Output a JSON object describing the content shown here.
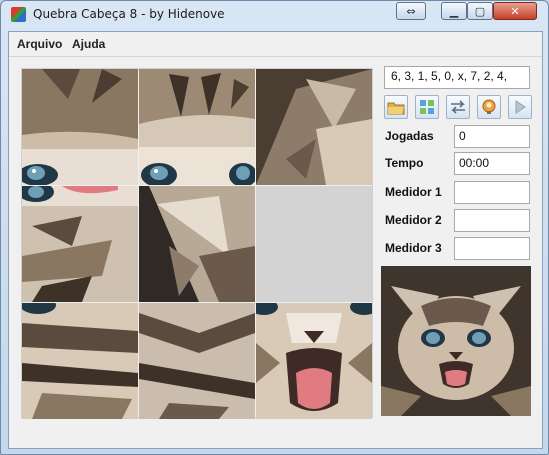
{
  "window": {
    "title": "Quebra Cabeça 8 - by Hidenove"
  },
  "menu": {
    "items": [
      "Arquivo",
      "Ajuda"
    ]
  },
  "board": {
    "layout": [
      "6",
      "3",
      "1",
      "5",
      "0",
      "x",
      "7",
      "2",
      "4"
    ],
    "empty_color": "#d3d3d3"
  },
  "side": {
    "sequence": "6, 3, 1, 5, 0, x, 7, 2, 4,",
    "stats": [
      {
        "label": "Jogadas",
        "value": "0"
      },
      {
        "label": "Tempo",
        "value": "00:00"
      },
      {
        "label": "Medidor 1",
        "value": ""
      },
      {
        "label": "Medidor 2",
        "value": ""
      },
      {
        "label": "Medidor 3",
        "value": ""
      }
    ]
  },
  "toolbar": {
    "icons": [
      "open-folder-icon",
      "shuffle-grid-icon",
      "solve-icon",
      "hint-icon",
      "play-icon"
    ]
  },
  "colors": {
    "fur_light": "#d9cab8",
    "fur_dark": "#5a4b3e",
    "eye": "#6f9fb6",
    "tongue": "#e07b82"
  }
}
